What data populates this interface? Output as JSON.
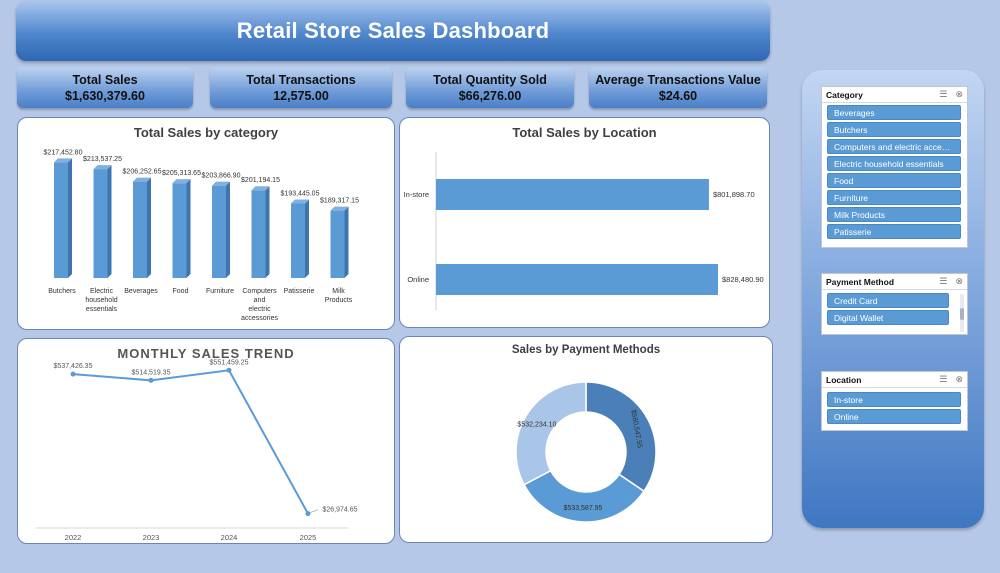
{
  "dashboard": {
    "title": "Retail Store Sales Dashboard"
  },
  "kpis": [
    {
      "label": "Total Sales",
      "value": "$1,630,379.60"
    },
    {
      "label": "Total Transactions",
      "value": "12,575.00"
    },
    {
      "label": "Total Quantity Sold",
      "value": "$66,276.00"
    },
    {
      "label": "Average Transactions Value",
      "value": "$24.60"
    }
  ],
  "colors": {
    "bar": "#5b9bd5",
    "bar_side": "#3e75ad",
    "line": "#5b9bd5",
    "donut": [
      "#4a7fb8",
      "#5b9bd5",
      "#a9c5e8"
    ]
  },
  "charts": {
    "category": {
      "title": "Total Sales by category",
      "chart_data": {
        "type": "bar",
        "title": "Total Sales by category",
        "categories": [
          [
            "Butchers"
          ],
          [
            "Electric",
            "household",
            "essentials"
          ],
          [
            "Beverages"
          ],
          [
            "Food"
          ],
          [
            "Furniture"
          ],
          [
            "Computers",
            "and",
            "electric",
            "accessories"
          ],
          [
            "Patisserie"
          ],
          [
            "Milk",
            "Products"
          ]
        ],
        "values": [
          217452.8,
          213537.25,
          206252.65,
          205313.65,
          203866.9,
          201194.15,
          193445.05,
          189317.15
        ],
        "labels": [
          "$217,452.80",
          "$213,537.25",
          "$206,252.65",
          "$205,313.65",
          "$203,866.90",
          "$201,194.15",
          "$193,445.05",
          "$189,317.15"
        ],
        "ylim": [
          180000,
          220000
        ]
      }
    },
    "location": {
      "title": "Total Sales by Location",
      "chart_data": {
        "type": "bar",
        "orientation": "horizontal",
        "title": "Total Sales by Location",
        "categories": [
          "In-store",
          "Online"
        ],
        "values": [
          801898.7,
          828480.9
        ],
        "labels": [
          "$801,898.70",
          "$828,480.90"
        ],
        "xlim": [
          0,
          828480.9
        ]
      }
    },
    "monthly": {
      "title": "MONTHLY SALES TREND",
      "chart_data": {
        "type": "line",
        "title": "MONTHLY SALES TREND",
        "x": [
          "2022",
          "2023",
          "2024",
          "2025"
        ],
        "values": [
          537426.35,
          514519.35,
          551459.25,
          26974.65
        ],
        "labels": [
          "$537,426.35",
          "$514,519.35",
          "$551,459.25",
          "$26,974.65"
        ],
        "ylim": [
          0,
          600000
        ]
      }
    },
    "payment": {
      "title": "Sales by Payment Methods",
      "chart_data": {
        "type": "pie",
        "title": "Sales by Payment Methods",
        "values": [
          560547.55,
          533587.95,
          532234.1
        ],
        "labels": [
          "$560,547.55",
          "$533,587.95",
          "$532,234.10"
        ]
      }
    }
  },
  "slicers": {
    "category": {
      "title": "Category",
      "items": [
        "Beverages",
        "Butchers",
        "Computers and electric accessories",
        "Electric household essentials",
        "Food",
        "Furniture",
        "Milk Products",
        "Patisserie"
      ]
    },
    "payment": {
      "title": "Payment Method",
      "items": [
        "Credit Card",
        "Digital Wallet"
      ]
    },
    "location": {
      "title": "Location",
      "items": [
        "In-store",
        "Online"
      ]
    },
    "icons": {
      "multi_select": "multi-select-icon",
      "clear_filter": "clear-filter-icon"
    }
  }
}
